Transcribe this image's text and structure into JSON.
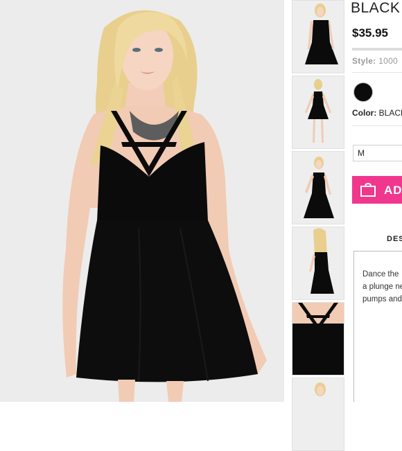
{
  "product": {
    "title": "BLACK",
    "price": "$35.95",
    "style_label": "Style:",
    "style_value": "1000",
    "color_label": "Color:",
    "color_value": "BLACK",
    "swatch_color": "#0b0b0b",
    "size_selected": "M",
    "add_button_label": "AD",
    "accent_color": "#f0378d"
  },
  "tabs": {
    "description_label": "DES"
  },
  "description": {
    "lines": [
      "Dance the",
      "a plunge ne",
      "pumps and"
    ]
  },
  "thumbnails": [
    {
      "name": "thumb-front-view"
    },
    {
      "name": "thumb-full-length-view"
    },
    {
      "name": "thumb-side-view"
    },
    {
      "name": "thumb-back-view"
    },
    {
      "name": "thumb-detail-view"
    },
    {
      "name": "thumb-extra-view"
    }
  ],
  "icons": {
    "bag": "shopping-bag-icon"
  }
}
